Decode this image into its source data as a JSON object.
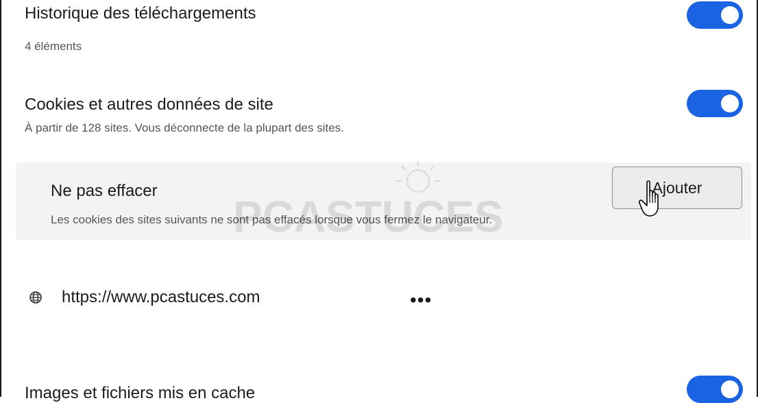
{
  "settings": {
    "download_history": {
      "title": "Historique des téléchargements",
      "subtitle": "4 éléments",
      "enabled": true
    },
    "cookies": {
      "title": "Cookies et autres données de site",
      "subtitle": "À partir de 128 sites. Vous déconnecte de la plupart des sites.",
      "enabled": true
    },
    "do_not_clear": {
      "title": "Ne pas effacer",
      "description": "Les cookies des sites suivants ne sont pas effacés lorsque vous fermez le navigateur.",
      "add_button_label": "Ajouter"
    },
    "sites": [
      {
        "url": "https://www.pcastuces.com",
        "icon": "globe-icon",
        "more_label": "•••"
      }
    ],
    "cached_images": {
      "title": "Images et fichiers mis en cache",
      "enabled": true
    }
  },
  "watermark": {
    "text": "PCASTUCES"
  },
  "colors": {
    "toggle_on": "#1a64e4",
    "panel_bg": "#f3f3f3"
  }
}
